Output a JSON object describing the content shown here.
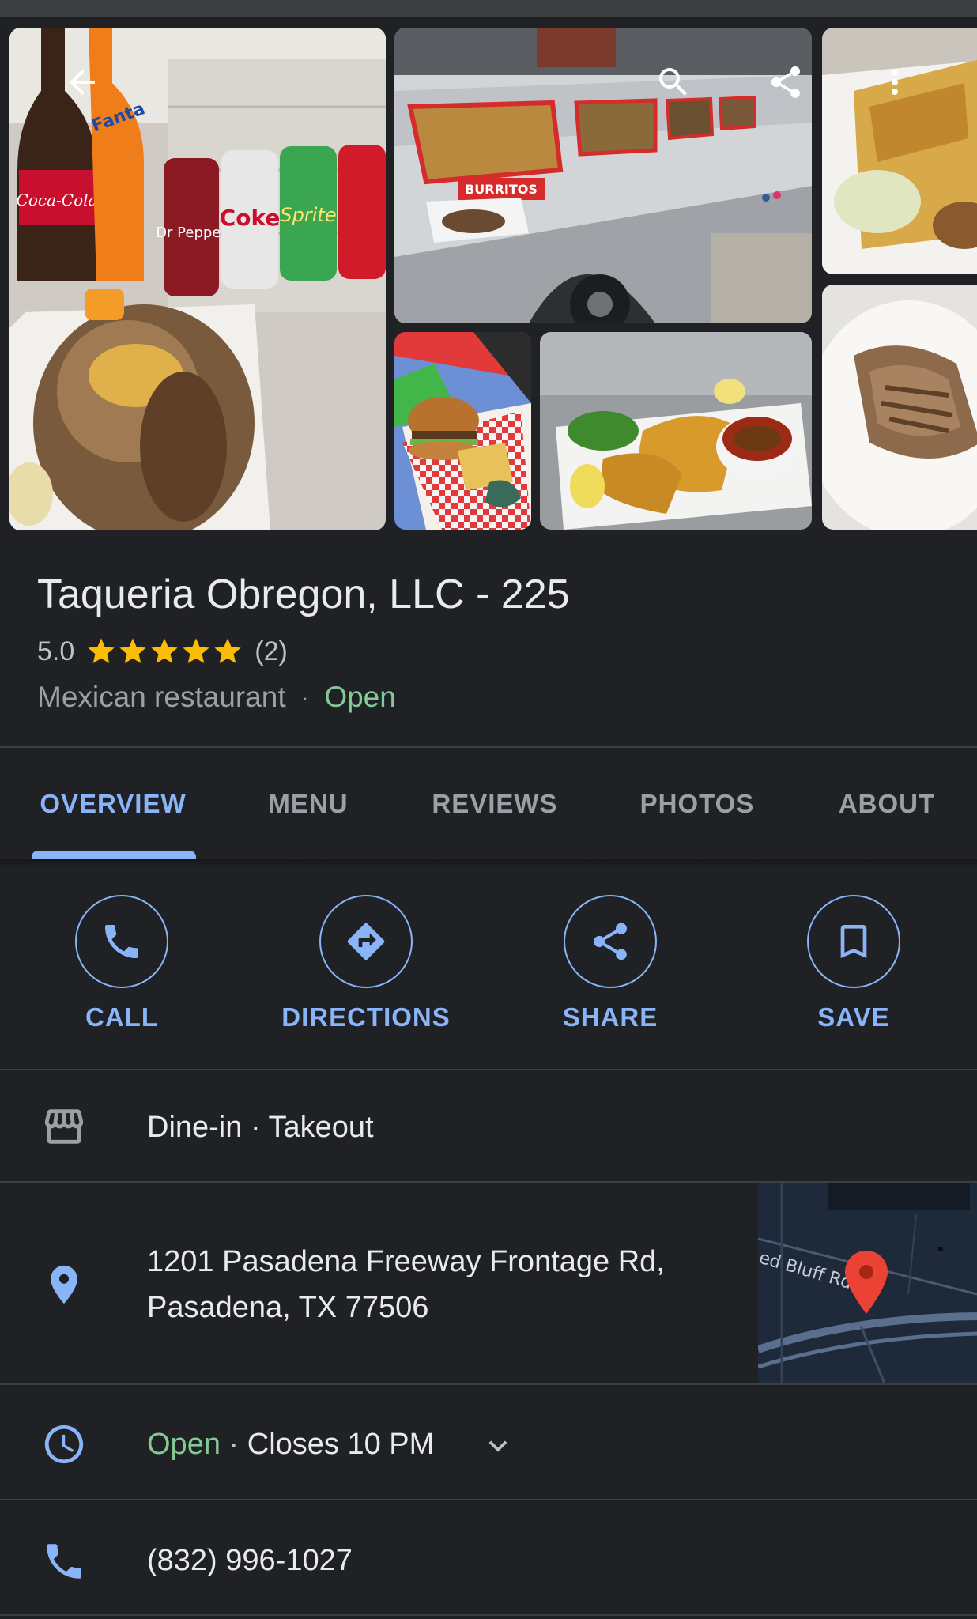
{
  "place": {
    "name": "Taqueria Obregon, LLC - 225",
    "rating": "5.0",
    "stars": 5,
    "review_count": "(2)",
    "category": "Mexican restaurant",
    "separator": "·",
    "status": "Open"
  },
  "tabs": [
    {
      "label": "OVERVIEW",
      "active": true
    },
    {
      "label": "MENU",
      "active": false
    },
    {
      "label": "REVIEWS",
      "active": false
    },
    {
      "label": "PHOTOS",
      "active": false
    },
    {
      "label": "ABOUT",
      "active": false
    }
  ],
  "actions": [
    {
      "label": "CALL",
      "icon": "phone-icon"
    },
    {
      "label": "DIRECTIONS",
      "icon": "directions-icon"
    },
    {
      "label": "SHARE",
      "icon": "share-icon"
    },
    {
      "label": "SAVE",
      "icon": "bookmark-icon"
    }
  ],
  "service_options": "Dine-in · Takeout",
  "address": {
    "line1": "1201 Pasadena Freeway Frontage Rd,",
    "line2": "Pasadena, TX 77506"
  },
  "map": {
    "street_label": "ed Bluff Rd"
  },
  "hours": {
    "status": "Open",
    "separator": " · ",
    "closes": "Closes 10 PM"
  },
  "phone": "(832) 996-1027",
  "photos": {
    "p1_brand_1": "Coca-Cola",
    "p1_brand_2": "Fanta",
    "p1_brand_3": "Dr Pepper",
    "p1_brand_4": "Coke",
    "p1_brand_5": "Sprite",
    "p2_sign": "BURRITOS"
  },
  "colors": {
    "background": "#202124",
    "accent": "#8ab4f8",
    "open_green": "#81c995",
    "star": "#fbbc04",
    "map_pin": "#ea4335"
  }
}
